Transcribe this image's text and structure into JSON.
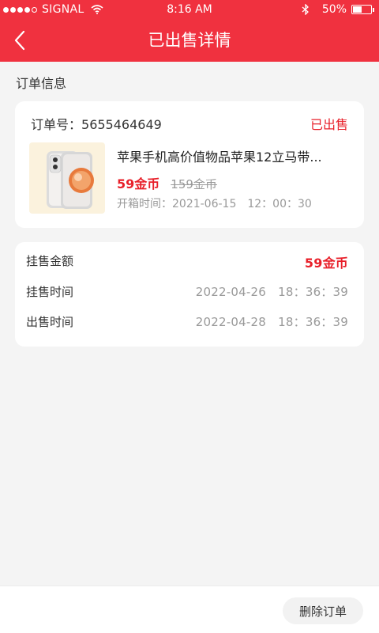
{
  "status_bar": {
    "carrier": "SIGNAL",
    "time": "8:16 AM",
    "battery": "50%",
    "battery_level": 0.5
  },
  "nav": {
    "title": "已出售详情",
    "back_icon": "chevron-left-icon"
  },
  "section_title": "订单信息",
  "order": {
    "order_no_label": "订单号：",
    "order_no": "5655464649",
    "status": "已出售",
    "product_name": "苹果手机高价值物品苹果12立马带...",
    "price": "59金币",
    "original_price": "159金币",
    "open_time_label": "开箱时间：",
    "open_time": "2021-06-15　12：00：30"
  },
  "listing": {
    "rows": [
      {
        "label": "挂售金额",
        "value": "59金币"
      },
      {
        "label": "挂售时间",
        "value": "2022-04-26　18：36：39"
      },
      {
        "label": "出售时间",
        "value": "2022-04-28　18：36：39"
      }
    ]
  },
  "actions": {
    "delete_order": "删除订单"
  },
  "colors": {
    "brand": "#f0313f",
    "price": "#e8202a",
    "background": "#f4f4f4"
  }
}
